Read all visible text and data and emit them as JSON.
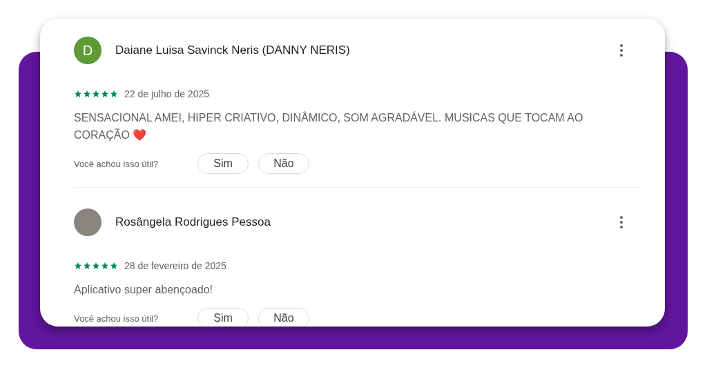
{
  "reviews": [
    {
      "author": "Daiane Luisa Savinck Neris (DANNY NERIS)",
      "avatar": {
        "kind": "letter",
        "letter": "D",
        "color": "#5e9a35"
      },
      "stars": 5,
      "date": "22 de julho de 2025",
      "text": "SENSACIONAL AMEI, HIPER CRIATIVO, DINÂMICO, SOM AGRADÁVEL. MUSICAS QUE TOCAM AO CORAÇÃO ❤️",
      "helpful_prompt": "Você achou isso útil?",
      "buttons": [
        "Sim",
        "Não"
      ]
    },
    {
      "author": "Rosângela Rodrigues Pessoa",
      "avatar": {
        "kind": "photo"
      },
      "stars": 5,
      "date": "28 de fevereiro de 2025",
      "text": "Aplicativo super abençoado!",
      "helpful_prompt": "Você achou isso útil?",
      "buttons": [
        "Sim",
        "Não"
      ]
    }
  ]
}
